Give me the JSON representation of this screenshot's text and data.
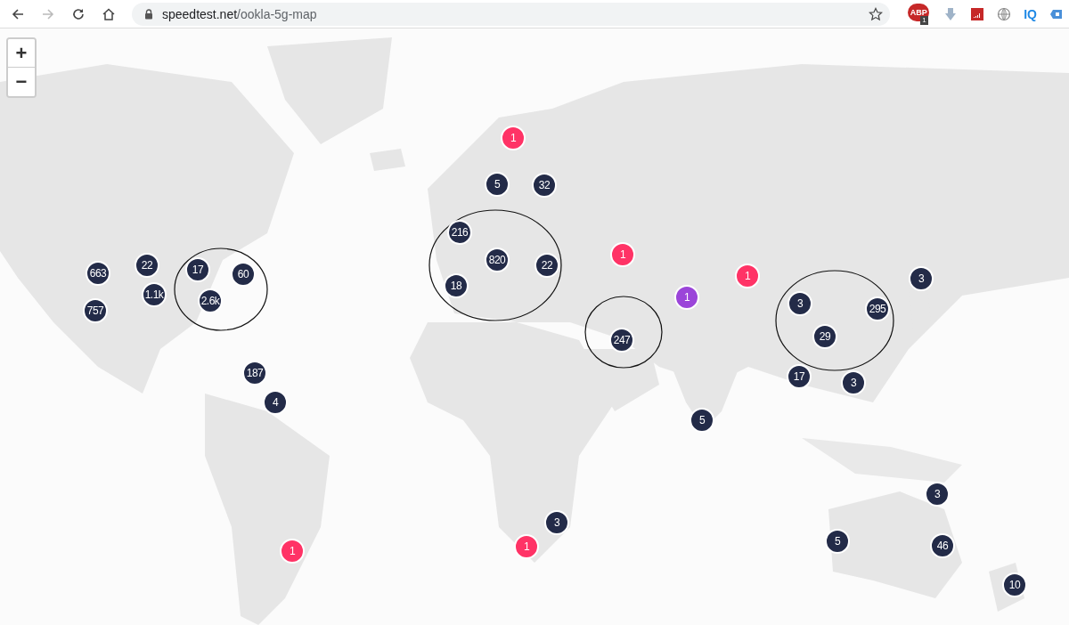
{
  "browser": {
    "url_host": "speedtest.net",
    "url_path": "/ookla-5g-map",
    "extensions": [
      {
        "kind": "abp",
        "label": "ABP",
        "badge": "1"
      },
      {
        "kind": "download"
      },
      {
        "kind": "chart"
      },
      {
        "kind": "globe"
      },
      {
        "kind": "iq",
        "label": "IQ"
      },
      {
        "kind": "tag"
      }
    ]
  },
  "map": {
    "kind": "picture",
    "zoom_controls": [
      "+",
      "−"
    ],
    "markers": [
      {
        "label": "1",
        "color": "#ff3366"
      },
      {
        "label": "5",
        "color": "#232b48"
      },
      {
        "label": "32",
        "color": "#232b48"
      },
      {
        "label": "216",
        "color": "#232b48"
      },
      {
        "label": "1",
        "color": "#ff3366"
      },
      {
        "label": "820",
        "color": "#232b48"
      },
      {
        "label": "22",
        "color": "#232b48"
      },
      {
        "label": "663",
        "color": "#232b48"
      },
      {
        "label": "22",
        "color": "#232b48"
      },
      {
        "label": "17",
        "color": "#232b48"
      },
      {
        "label": "60",
        "color": "#232b48"
      },
      {
        "label": "1",
        "color": "#ff3366"
      },
      {
        "label": "3",
        "color": "#232b48"
      },
      {
        "label": "18",
        "color": "#232b48"
      },
      {
        "label": "1.1k",
        "color": "#232b48"
      },
      {
        "label": "1",
        "color": "#9b45d9"
      },
      {
        "label": "2.6k",
        "color": "#232b48"
      },
      {
        "label": "3",
        "color": "#232b48"
      },
      {
        "label": "295",
        "color": "#232b48"
      },
      {
        "label": "757",
        "color": "#232b48"
      },
      {
        "label": "29",
        "color": "#232b48"
      },
      {
        "label": "247",
        "color": "#232b48"
      },
      {
        "label": "187",
        "color": "#232b48"
      },
      {
        "label": "17",
        "color": "#232b48"
      },
      {
        "label": "3",
        "color": "#232b48"
      },
      {
        "label": "4",
        "color": "#232b48"
      },
      {
        "label": "5",
        "color": "#232b48"
      },
      {
        "label": "3",
        "color": "#232b48"
      },
      {
        "label": "3",
        "color": "#232b48"
      },
      {
        "label": "1",
        "color": "#ff3366"
      },
      {
        "label": "1",
        "color": "#ff3366"
      },
      {
        "label": "5",
        "color": "#232b48"
      },
      {
        "label": "46",
        "color": "#232b48"
      },
      {
        "label": "10",
        "color": "#232b48"
      }
    ]
  }
}
